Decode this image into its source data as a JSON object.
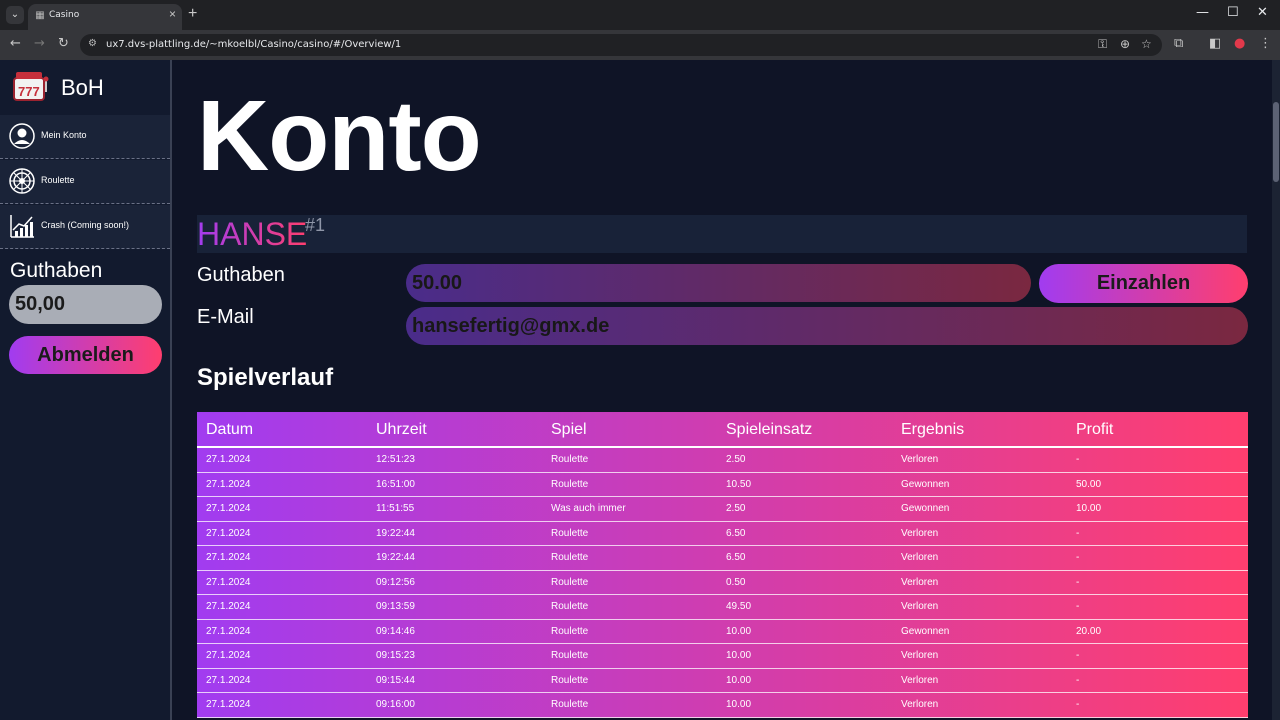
{
  "browser": {
    "tab_title": "Casino",
    "url": "ux7.dvs-plattling.de/~mkoelbl/Casino/casino/#/Overview/1",
    "new_tab_symbol": "+",
    "close_symbol": "×"
  },
  "sidebar": {
    "brand": "BoH",
    "items": [
      {
        "label": "Mein Konto",
        "icon": "user-icon"
      },
      {
        "label": "Roulette",
        "icon": "roulette-wheel-icon"
      },
      {
        "label": "Crash (Coming soon!)",
        "icon": "chart-up-icon"
      }
    ],
    "balance_label": "Guthaben",
    "balance_value": "50,00",
    "logout_label": "Abmelden"
  },
  "account": {
    "title": "Konto",
    "username": "HANSE",
    "user_id": "#1",
    "balance_label": "Guthaben",
    "balance_value": "50.00",
    "deposit_label": "Einzahlen",
    "email_label": "E-Mail",
    "email_value": "hansefertig@gmx.de"
  },
  "history": {
    "title": "Spielverlauf",
    "columns": [
      "Datum",
      "Uhrzeit",
      "Spiel",
      "Spieleinsatz",
      "Ergebnis",
      "Profit"
    ],
    "rows": [
      [
        "27.1.2024",
        "12:51:23",
        "Roulette",
        "2.50",
        "Verloren",
        "-"
      ],
      [
        "27.1.2024",
        "16:51:00",
        "Roulette",
        "10.50",
        "Gewonnen",
        "50.00"
      ],
      [
        "27.1.2024",
        "11:51:55",
        "Was auch immer",
        "2.50",
        "Gewonnen",
        "10.00"
      ],
      [
        "27.1.2024",
        "19:22:44",
        "Roulette",
        "6.50",
        "Verloren",
        "-"
      ],
      [
        "27.1.2024",
        "19:22:44",
        "Roulette",
        "6.50",
        "Verloren",
        "-"
      ],
      [
        "27.1.2024",
        "09:12:56",
        "Roulette",
        "0.50",
        "Verloren",
        "-"
      ],
      [
        "27.1.2024",
        "09:13:59",
        "Roulette",
        "49.50",
        "Verloren",
        "-"
      ],
      [
        "27.1.2024",
        "09:14:46",
        "Roulette",
        "10.00",
        "Gewonnen",
        "20.00"
      ],
      [
        "27.1.2024",
        "09:15:23",
        "Roulette",
        "10.00",
        "Verloren",
        "-"
      ],
      [
        "27.1.2024",
        "09:15:44",
        "Roulette",
        "10.00",
        "Verloren",
        "-"
      ],
      [
        "27.1.2024",
        "09:16:00",
        "Roulette",
        "10.00",
        "Verloren",
        "-"
      ]
    ]
  },
  "colors": {
    "accent_start": "#a13cf0",
    "accent_end": "#ff3e6e",
    "background": "#0f1426"
  }
}
